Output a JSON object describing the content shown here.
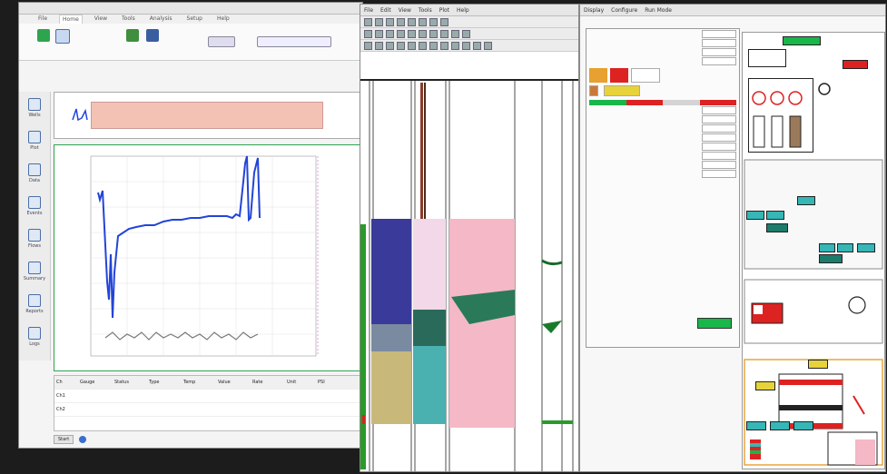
{
  "left_window": {
    "title": "",
    "ribbon_tabs": [
      "File",
      "Home",
      "View",
      "Tools",
      "Analysis",
      "Setup",
      "Help"
    ],
    "active_tab": 1,
    "side_items": [
      "Wells",
      "Plot",
      "Data",
      "Events",
      "Flows",
      "Summary",
      "Reports",
      "Logs"
    ],
    "top_plot_title": "",
    "main_plot_title": "",
    "legend": [
      "",
      "",
      "",
      "",
      "",
      ""
    ],
    "table_headers": [
      "Ch",
      "Gauge",
      "Status",
      "Type",
      "Temp",
      "Value",
      "Rate",
      "Unit",
      "PSI"
    ],
    "table_rows": [
      [
        "Ch1",
        "",
        "",
        "",
        "",
        "",
        "",
        "",
        ""
      ],
      [
        "Ch2",
        "",
        "",
        "",
        "",
        "",
        "",
        "",
        ""
      ]
    ],
    "bottom_button": "Start",
    "bottom_label": ""
  },
  "middle_window": {
    "menu": [
      "File",
      "Edit",
      "View",
      "Tools",
      "Plot",
      "Help"
    ],
    "depth_labels": [
      "",
      "",
      "",
      ""
    ]
  },
  "right_window": {
    "menu": [
      "Display",
      "Configure",
      "Run Mode"
    ],
    "dialog_fields": [
      "",
      "",
      "",
      "",
      "",
      "",
      "",
      "",
      "",
      "",
      "",
      ""
    ],
    "dialog_section": "",
    "schematic_labels": [
      "",
      "",
      "",
      ""
    ]
  },
  "colors": {
    "series_blue": "#2244d8",
    "series_grey": "#7a7a7a",
    "accent_green": "#2ea44f",
    "pink_band": "#f4c2c2",
    "orange": "#e8a030",
    "red": "#d84030",
    "teal": "#36b6b6"
  }
}
